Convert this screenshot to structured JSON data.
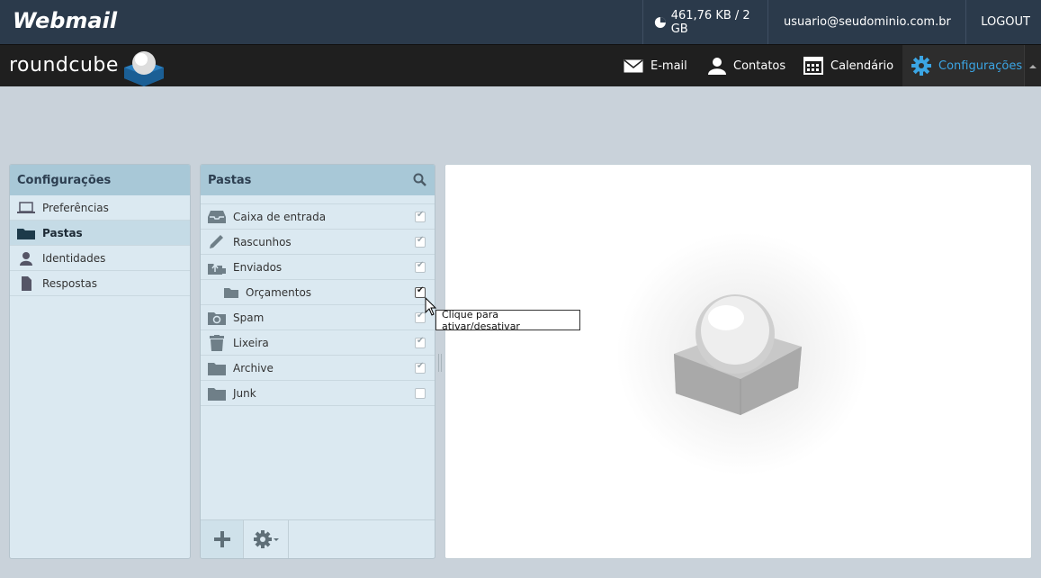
{
  "topbar": {
    "logo": "Webmail",
    "quota": "461,76 KB / 2 GB",
    "user": "usuario@seudominio.com.br",
    "logout": "LOGOUT"
  },
  "rcbar": {
    "logo": "roundcube",
    "nav": {
      "email": "E-mail",
      "contacts": "Contatos",
      "calendar": "Calendário",
      "settings": "Configurações"
    },
    "active_color": "#3ba5e4"
  },
  "settings_panel": {
    "title": "Configurações",
    "items": [
      {
        "label": "Preferências",
        "icon": "laptop-icon"
      },
      {
        "label": "Pastas",
        "icon": "folder-icon"
      },
      {
        "label": "Identidades",
        "icon": "person-icon"
      },
      {
        "label": "Respostas",
        "icon": "document-icon"
      }
    ]
  },
  "folders_panel": {
    "title": "Pastas",
    "items": [
      {
        "label": "Caixa de entrada",
        "icon": "inbox-icon",
        "subscribed": true
      },
      {
        "label": "Rascunhos",
        "icon": "pencil-icon",
        "subscribed": true
      },
      {
        "label": "Enviados",
        "icon": "sent-icon",
        "subscribed": true
      },
      {
        "label": "Orçamentos",
        "icon": "folder-icon",
        "subscribed": true
      },
      {
        "label": "Spam",
        "icon": "spam-icon",
        "subscribed": true
      },
      {
        "label": "Lixeira",
        "icon": "trash-icon",
        "subscribed": true
      },
      {
        "label": "Archive",
        "icon": "folder-icon",
        "subscribed": true
      },
      {
        "label": "Junk",
        "icon": "folder-icon",
        "subscribed": false
      }
    ]
  },
  "tooltip": "Clique para ativar/desativar"
}
